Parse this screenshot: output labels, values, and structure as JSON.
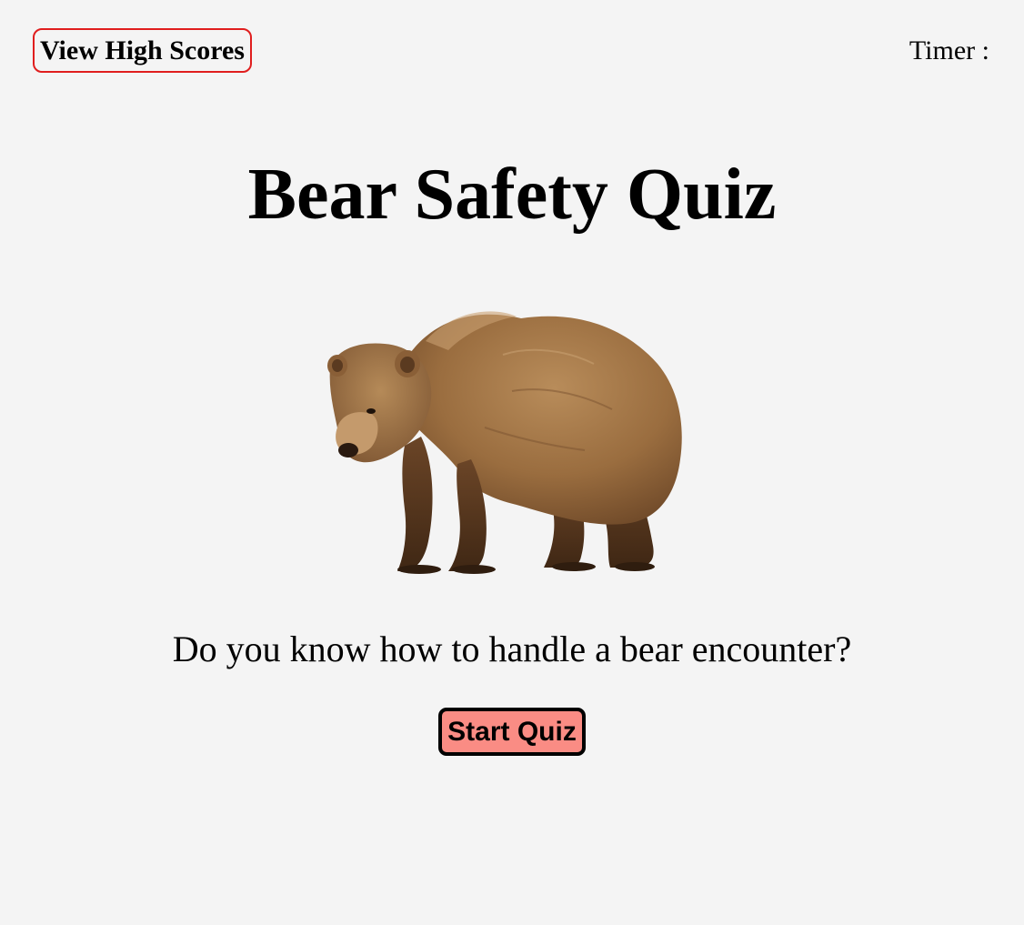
{
  "header": {
    "high_scores_label": "View High Scores",
    "timer_label": "Timer :",
    "high_scores_border_color": "#e01e1e"
  },
  "main": {
    "title": "Bear Safety Quiz",
    "image": {
      "icon": "brown-bear-illustration"
    },
    "tagline": "Do you know how to handle a bear encounter?",
    "start_button_label": "Start Quiz",
    "start_button_color": "#fa8c84"
  },
  "colors": {
    "background": "#f4f4f4",
    "text": "#000000"
  }
}
